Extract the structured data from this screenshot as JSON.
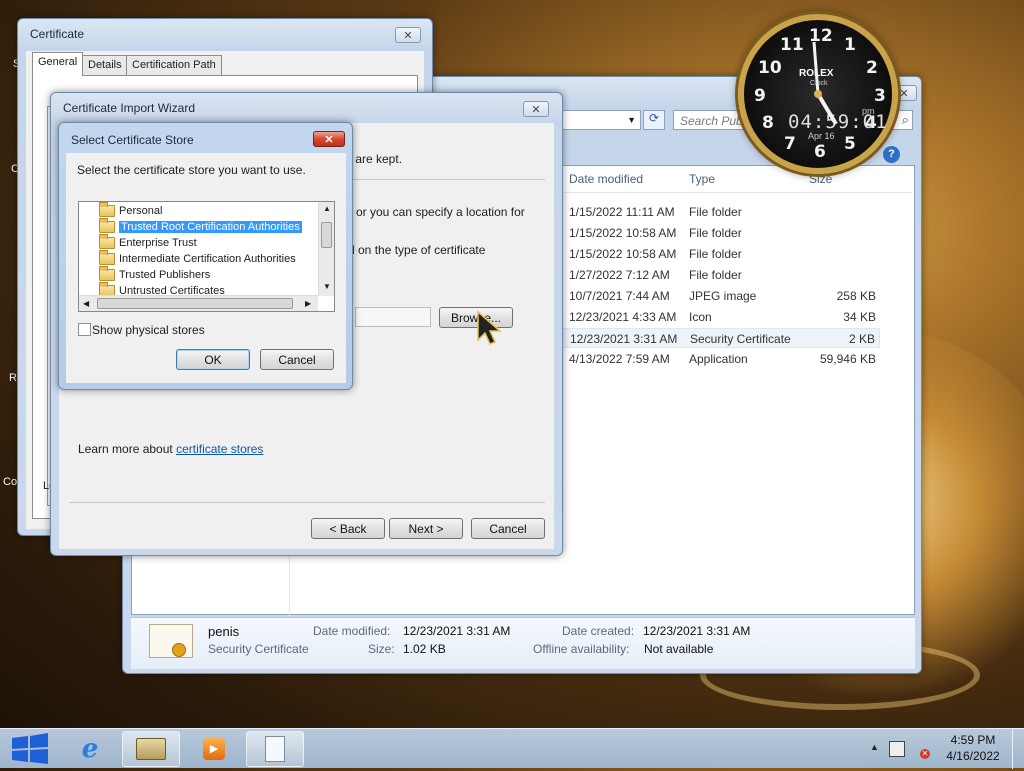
{
  "explorer": {
    "search_placeholder": "Search Publ",
    "columns": {
      "date": "Date modified",
      "type": "Type",
      "size": "Size"
    },
    "rows": [
      {
        "date": "1/15/2022 11:11 AM",
        "type": "File folder",
        "size": ""
      },
      {
        "date": "1/15/2022 10:58 AM",
        "type": "File folder",
        "size": ""
      },
      {
        "date": "1/15/2022 10:58 AM",
        "type": "File folder",
        "size": ""
      },
      {
        "date": "1/27/2022 7:12 AM",
        "type": "File folder",
        "size": ""
      },
      {
        "date": "10/7/2021 7:44 AM",
        "type": "JPEG image",
        "size": "258 KB"
      },
      {
        "date": "12/23/2021 4:33 AM",
        "type": "Icon",
        "size": "34 KB"
      },
      {
        "date": "12/23/2021 3:31 AM",
        "type": "Security Certificate",
        "size": "2 KB"
      },
      {
        "date": "4/13/2022 7:59 AM",
        "type": "Application",
        "size": "59,946 KB"
      }
    ],
    "details": {
      "name": "penis",
      "type": "Security Certificate",
      "modified_label": "Date modified:",
      "modified": "12/23/2021 3:31 AM",
      "size_label": "Size:",
      "size": "1.02 KB",
      "created_label": "Date created:",
      "created": "12/23/2021 3:31 AM",
      "offline_label": "Offline availability:",
      "offline": "Not available"
    }
  },
  "certificate": {
    "title": "Certificate",
    "tabs": [
      "General",
      "Details",
      "Certification Path"
    ],
    "left_text": "Le"
  },
  "wizard": {
    "title": "Certificate Import Wizard",
    "text1": "s are kept.",
    "text2": "or you can specify a location for",
    "text3": "d on the type of certificate",
    "browse": "Browse...",
    "learn_prefix": "Learn more about ",
    "learn_link": "certificate stores",
    "back": "< Back",
    "next": "Next >",
    "cancel": "Cancel"
  },
  "store_dialog": {
    "title": "Select Certificate Store",
    "instruction": "Select the certificate store you want to use.",
    "items": [
      "Personal",
      "Trusted Root Certification Authorities",
      "Enterprise Trust",
      "Intermediate Certification Authorities",
      "Trusted Publishers",
      "Untrusted Certificates"
    ],
    "selected_index": 1,
    "show_physical": "Show physical stores",
    "ok": "OK",
    "cancel": "Cancel"
  },
  "clock": {
    "brand": "ROLEX",
    "sub": "Clock",
    "digital": "04:59:01",
    "pm": "pm",
    "date": "Apr 16",
    "numerals": [
      "12",
      "1",
      "2",
      "3",
      "4",
      "5",
      "6",
      "7",
      "8",
      "9",
      "10",
      "11"
    ]
  },
  "desktop_edge": [
    "S",
    "C",
    "R",
    "Co"
  ],
  "taskbar": {
    "time": "4:59 PM",
    "date": "4/16/2022"
  }
}
